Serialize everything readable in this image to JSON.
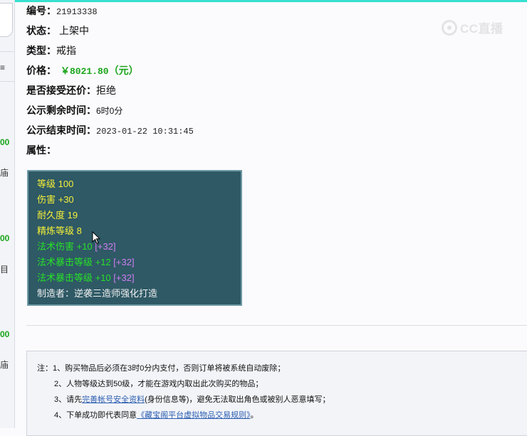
{
  "item": {
    "id_label": "编号：",
    "id_value": "21913338",
    "status_label": "状态：",
    "status_value": "上架中",
    "type_label": "类型：",
    "type_value": "戒指",
    "price_label": "价格：",
    "price_value": "￥8021.80",
    "price_unit": "（元）",
    "counteroffer_label": "是否接受还价：",
    "counteroffer_value": "拒绝",
    "remaining_label": "公示剩余时间：",
    "remaining_value": "6时0分",
    "end_label": "公示结束时间：",
    "end_value": "2023-01-22 10:31:45",
    "attr_label": "属性："
  },
  "attributes": [
    {
      "text": "等级 100",
      "bonus": "",
      "color": "#f5ef38"
    },
    {
      "text": "伤害 +30",
      "bonus": "",
      "color": "#f5ef38"
    },
    {
      "text": "耐久度 19",
      "bonus": "",
      "color": "#f5ef38"
    },
    {
      "text": "精炼等级 8",
      "bonus": "",
      "color": "#f5ef38"
    },
    {
      "text": "法术伤害 +10",
      "bonus": " [+32]",
      "color": "#28e028"
    },
    {
      "text": "法术暴击等级 +12",
      "bonus": " [+32]",
      "color": "#28e028"
    },
    {
      "text": "法术暴击等级 +10",
      "bonus": " [+32]",
      "color": "#28e028"
    },
    {
      "text": "制造者：逆袭三造师强化打造",
      "bonus": "",
      "color": "#f0f0f0"
    }
  ],
  "watermark": {
    "text": "CC直播",
    "icon": "cc-logo-icon"
  },
  "left_strip": {
    "fragments": [
      "≡",
      "00",
      "庙",
      "00",
      "目",
      "00",
      "庙"
    ]
  },
  "notes": {
    "prefix": "注：",
    "line1": "1、购买物品后必须在3时0分内支付，否则订单将被系统自动废除；",
    "line2": "2、人物等级达到50级，才能在游戏内取出此次购买的物品；",
    "line3_a": "3、请先",
    "line3_link": "完善帐号安全资料",
    "line3_b": "(身份信息等)，避免无法取出角色或被别人恶意填写；",
    "line4_a": "4、下单成功即代表同意",
    "line4_link": "《藏宝阁平台虚拟物品交易规则》",
    "line4_b": "。"
  },
  "colors": {
    "accent_green": "#1aa51a",
    "attr_box_bg": "#2e5965",
    "link": "#2a5db0"
  }
}
